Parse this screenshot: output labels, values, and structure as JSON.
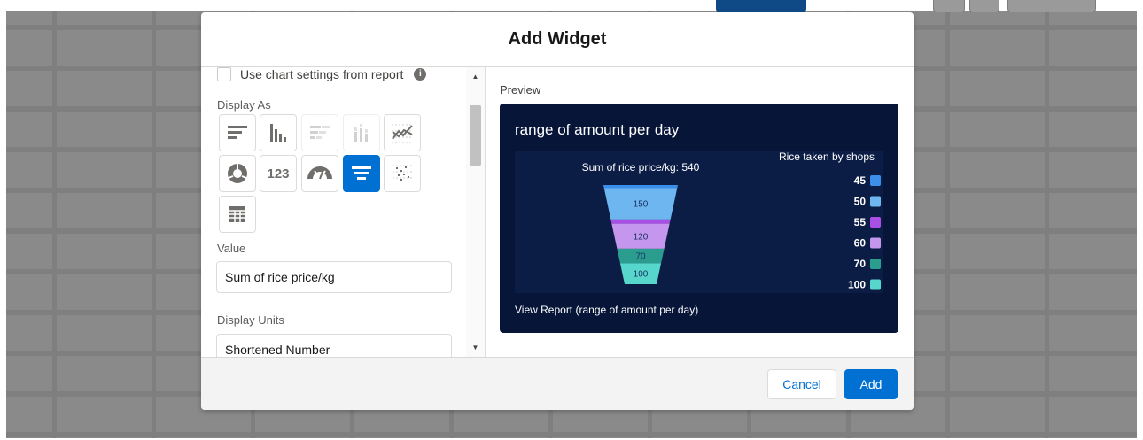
{
  "modal": {
    "title": "Add Widget",
    "checkbox_label": "Use chart settings from report",
    "display_as_label": "Display As",
    "display_types": [
      {
        "icon": "horizontal-bar-chart-icon",
        "state": "enabled"
      },
      {
        "icon": "vertical-bar-chart-icon",
        "state": "enabled"
      },
      {
        "icon": "stacked-horizontal-bar-icon",
        "state": "disabled"
      },
      {
        "icon": "stacked-vertical-bar-icon",
        "state": "disabled"
      },
      {
        "icon": "line-chart-icon",
        "state": "enabled"
      },
      {
        "icon": "donut-chart-icon",
        "state": "enabled"
      },
      {
        "icon": "metric-icon",
        "state": "enabled",
        "text": "123"
      },
      {
        "icon": "gauge-chart-icon",
        "state": "enabled"
      },
      {
        "icon": "funnel-chart-icon",
        "state": "selected"
      },
      {
        "icon": "scatter-chart-icon",
        "state": "enabled"
      },
      {
        "icon": "table-icon",
        "state": "enabled"
      }
    ],
    "value_label": "Value",
    "value": "Sum of rice price/kg",
    "display_units_label": "Display Units",
    "display_units_value": "Shortened Number",
    "preview_label": "Preview",
    "cancel_label": "Cancel",
    "add_label": "Add"
  },
  "preview": {
    "title": "range of amount per day",
    "view_report": "View Report (range of amount per day)"
  },
  "chart_data": {
    "type": "funnel",
    "title": "Sum of rice price/kg: 540",
    "legend_title": "Rice taken by shops",
    "legend_position": "right",
    "categories": [
      "45",
      "50",
      "55",
      "60",
      "70",
      "100"
    ],
    "values": [
      15,
      150,
      20,
      120,
      70,
      100
    ],
    "data_labels": [
      "",
      "150",
      "",
      "120",
      "70",
      "100"
    ],
    "total": 540,
    "colors": [
      "#3b8fea",
      "#6eb6ef",
      "#a94fe5",
      "#c596ee",
      "#2a9d8f",
      "#57d6cb"
    ]
  },
  "colors": {
    "brand": "#0070d2",
    "preview_bg": "#061538"
  }
}
